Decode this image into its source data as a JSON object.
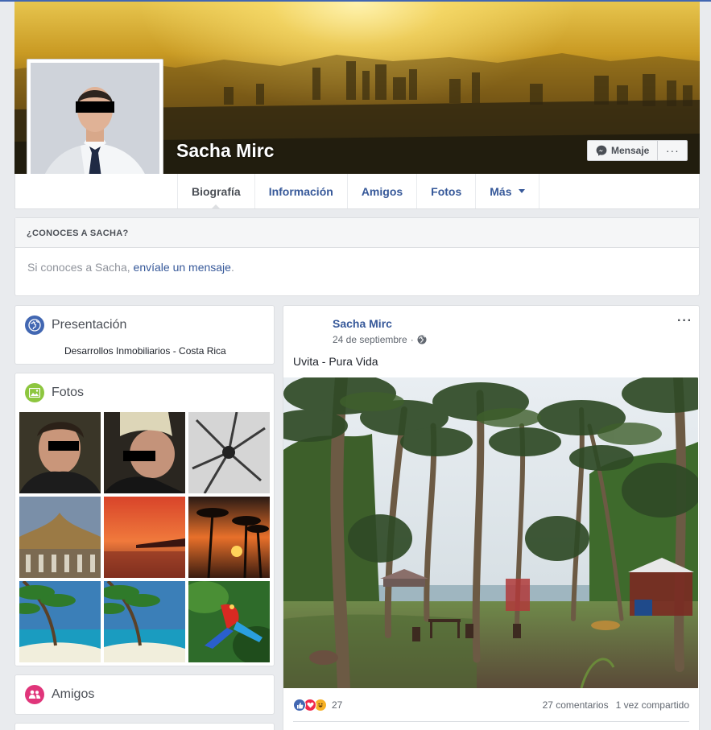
{
  "profile": {
    "name": "Sacha Mirc"
  },
  "cover_actions": {
    "message_label": "Mensaje",
    "more_label": "···"
  },
  "nav": {
    "tabs": [
      {
        "label": "Biografía",
        "active": true
      },
      {
        "label": "Información"
      },
      {
        "label": "Amigos"
      },
      {
        "label": "Fotos"
      },
      {
        "label": "Más"
      }
    ]
  },
  "know_box": {
    "heading": "¿CONOCES A SACHA?",
    "text_prefix": "Si conoces a Sacha, ",
    "link": "envíale un mensaje",
    "text_suffix": "."
  },
  "intro": {
    "title": "Presentación",
    "line": "Desarrollos Inmobiliarios - Costa Rica"
  },
  "photos": {
    "title": "Fotos"
  },
  "friends": {
    "title": "Amigos"
  },
  "post": {
    "author": "Sacha Mirc",
    "date": "24 de septiembre",
    "date_separator": " · ",
    "text": "Uvita - Pura Vida",
    "menu": "···",
    "reaction_count": "27",
    "comments": "27 comentarios",
    "shares": "1 vez compartido"
  },
  "colors": {
    "link": "#365899",
    "facebook_blue": "#4267b2",
    "page_bg": "#e9ebee",
    "like_blue": "#4267b2",
    "love_red": "#f0284a",
    "haha_yellow": "#f7b125"
  }
}
